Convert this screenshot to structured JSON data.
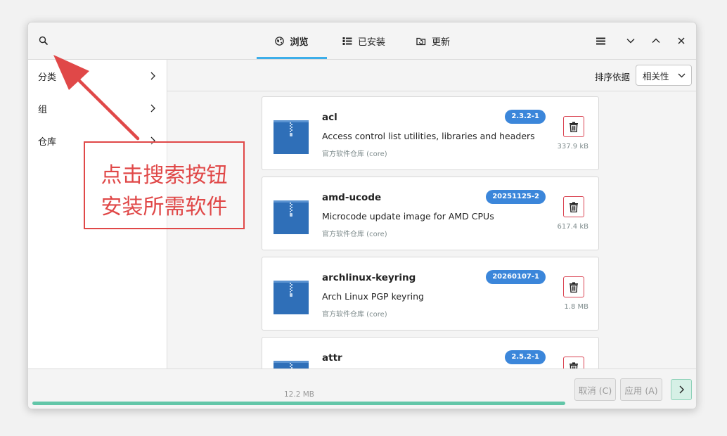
{
  "header": {
    "tabs": [
      {
        "label": "浏览",
        "icon": "globe-icon",
        "active": true
      },
      {
        "label": "已安装",
        "icon": "list-icon",
        "active": false
      },
      {
        "label": "更新",
        "icon": "update-icon",
        "active": false
      }
    ],
    "search_icon": "search-icon",
    "menu_icon": "hamburger-menu-icon",
    "minimize_icon": "chevron-down-icon",
    "maximize_icon": "chevron-up-icon",
    "close_icon": "close-icon"
  },
  "sidebar": {
    "items": [
      {
        "label": "分类"
      },
      {
        "label": "组"
      },
      {
        "label": "仓库"
      }
    ]
  },
  "toolbar": {
    "sort_label": "排序依据",
    "sort_value": "相关性"
  },
  "packages": [
    {
      "name": "acl",
      "description": "Access control list utilities, libraries and headers",
      "repo": "官方软件仓库 (core)",
      "version": "2.3.2-1",
      "size": "337.9 kB"
    },
    {
      "name": "amd-ucode",
      "description": "Microcode update image for AMD CPUs",
      "repo": "官方软件仓库 (core)",
      "version": "20251125-2",
      "size": "617.4 kB"
    },
    {
      "name": "archlinux-keyring",
      "description": "Arch Linux PGP keyring",
      "repo": "官方软件仓库 (core)",
      "version": "20260107-1",
      "size": "1.8 MB"
    },
    {
      "name": "attr",
      "description": "",
      "repo": "",
      "version": "2.5.2-1",
      "size": ""
    }
  ],
  "footer": {
    "total_size": "12.2 MB",
    "progress": 1.0,
    "cancel_label": "取消 (C)",
    "apply_label": "应用 (A)",
    "next_icon": "chevron-right-icon"
  },
  "annotation": {
    "line1": "点击搜索按钮",
    "line2": "安装所需软件"
  },
  "colors": {
    "accent": "#3daee9",
    "version_badge": "#3b86da",
    "remove": "#da4453",
    "progress": "#62c6a8",
    "annotation": "#e04848"
  }
}
